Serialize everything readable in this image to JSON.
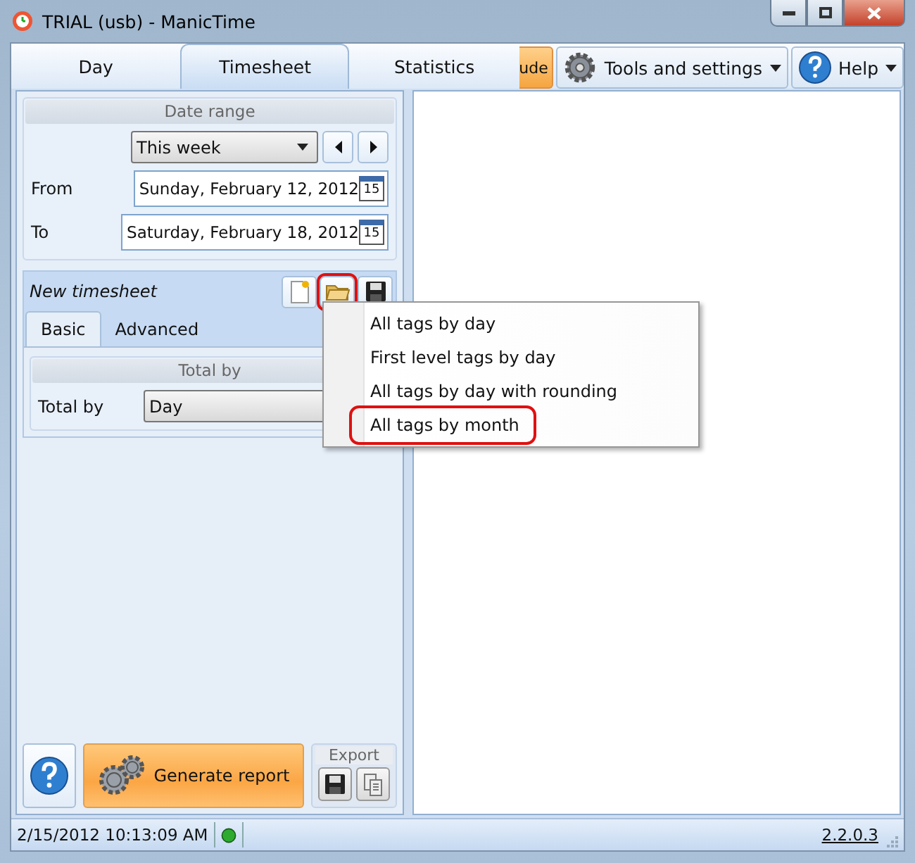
{
  "window": {
    "title": "TRIAL (usb) - ManicTime"
  },
  "tabs": [
    {
      "label": "Day",
      "selected": false
    },
    {
      "label": "Timesheet",
      "selected": true
    },
    {
      "label": "Statistics",
      "selected": false
    }
  ],
  "toolbar": [
    {
      "kind": "upgrade",
      "label": "ude"
    },
    {
      "kind": "tools",
      "label": "Tools and settings"
    },
    {
      "kind": "help",
      "label": "Help"
    }
  ],
  "date_range": {
    "title": "Date range",
    "preset": "This week",
    "from_label": "From",
    "from": "Sunday, February 12, 2012",
    "from_day": "15",
    "to_label": "To",
    "to": "Saturday, February 18, 2012",
    "to_day": "15"
  },
  "timesheet": {
    "name": "New timesheet",
    "buttons": [
      {
        "kind": "new",
        "marked": false
      },
      {
        "kind": "open",
        "marked": true
      },
      {
        "kind": "save",
        "marked": false
      }
    ],
    "tabs": [
      {
        "label": "Basic",
        "selected": true
      },
      {
        "label": "Advanced",
        "selected": false
      }
    ],
    "total_by": {
      "title": "Total by",
      "label": "Total by",
      "value": "Day"
    }
  },
  "menu": {
    "items": [
      {
        "label": "All tags by day",
        "marked": false
      },
      {
        "label": "First level tags by day",
        "marked": false
      },
      {
        "label": "All tags by day with rounding",
        "marked": false
      },
      {
        "label": "All tags by month",
        "marked": true
      }
    ]
  },
  "footer": {
    "generate": "Generate report",
    "export_title": "Export"
  },
  "status_bar": {
    "time": "2/15/2012 10:13:09 AM",
    "connected": true,
    "version": "2.2.0.3"
  }
}
